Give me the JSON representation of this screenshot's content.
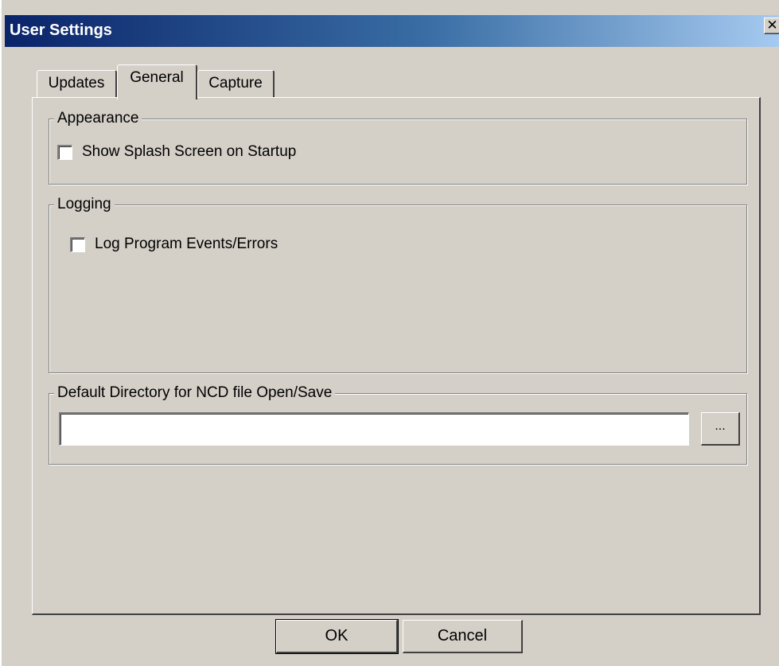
{
  "window": {
    "title": "User Settings",
    "close_glyph": "✕"
  },
  "tabs": [
    {
      "label": "Updates",
      "selected": false
    },
    {
      "label": "General",
      "selected": true
    },
    {
      "label": "Capture",
      "selected": false
    }
  ],
  "appearance": {
    "legend": "Appearance",
    "splash_label": "Show Splash Screen on Startup",
    "splash_checked": false
  },
  "logging": {
    "legend": "Logging",
    "log_label": "Log Program Events/Errors",
    "log_checked": false
  },
  "directory": {
    "legend": "Default Directory for NCD file Open/Save",
    "value": "",
    "browse_label": "..."
  },
  "buttons": {
    "ok": "OK",
    "cancel": "Cancel"
  },
  "colors": {
    "dialog_bg": "#d4d0c8",
    "titlebar_start": "#0a246a",
    "titlebar_end": "#a6caf0"
  }
}
